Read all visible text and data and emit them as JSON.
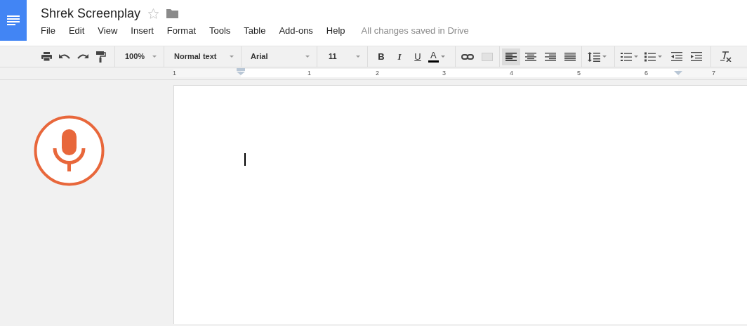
{
  "document": {
    "title": "Shrek Screenplay",
    "starred": false
  },
  "menu": [
    {
      "label": "File"
    },
    {
      "label": "Edit"
    },
    {
      "label": "View"
    },
    {
      "label": "Insert"
    },
    {
      "label": "Format"
    },
    {
      "label": "Tools"
    },
    {
      "label": "Table"
    },
    {
      "label": "Add-ons"
    },
    {
      "label": "Help"
    }
  ],
  "save_status": "All changes saved in Drive",
  "toolbar": {
    "zoom": "100%",
    "style": "Normal text",
    "font": "Arial",
    "size": "11",
    "format_buttons": [
      "B",
      "I",
      "U",
      "A"
    ],
    "alignment": [
      {
        "selected": true
      },
      {
        "selected": false
      },
      {
        "selected": false
      },
      {
        "selected": false
      }
    ]
  },
  "ruler": [
    "1",
    "1",
    "2",
    "3",
    "4",
    "5",
    "6",
    "7"
  ]
}
